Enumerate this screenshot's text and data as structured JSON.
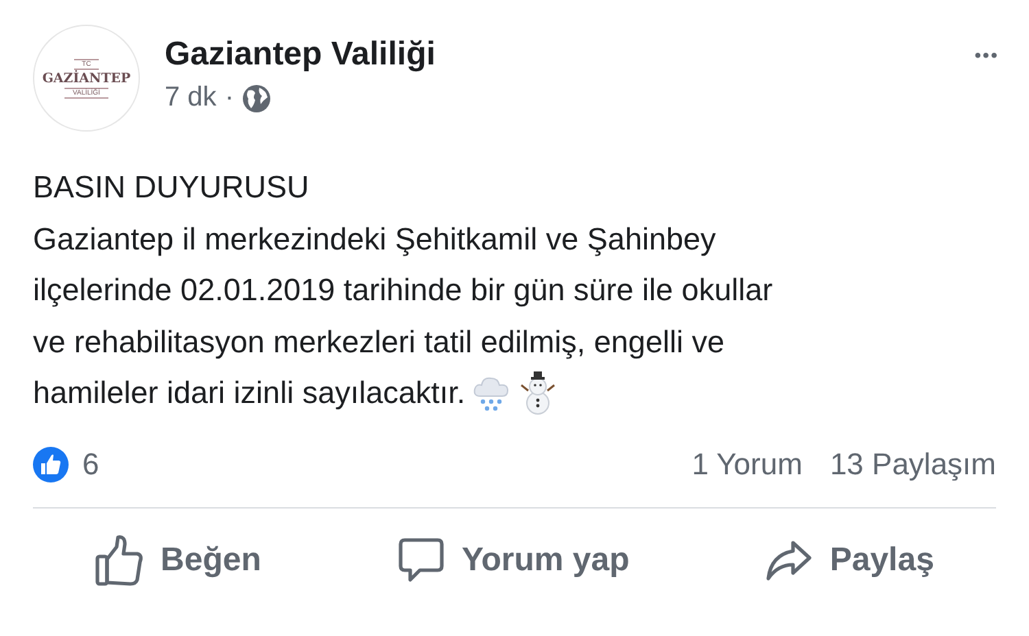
{
  "post": {
    "author": "Gaziantep Valiliği",
    "logo": {
      "top": "TC",
      "main": "GAZİANTEP",
      "bottom": "VALİLİĞİ"
    },
    "time": "7 dk",
    "separator": "·",
    "more": "•••",
    "lines": [
      "BASIN DUYURUSU",
      "Gaziantep il merkezindeki Şehitkamil ve Şahinbey",
      "ilçelerinde 02.01.2019 tarihinde bir gün süre ile okullar",
      "ve rehabilitasyon merkezleri tatil edilmiş, engelli ve",
      "hamileler idari izinli sayılacaktır."
    ],
    "reactions": "6",
    "comments": "1 Yorum",
    "shares": "13 Paylaşım",
    "actions": [
      {
        "kind": "like",
        "label": "Beğen"
      },
      {
        "kind": "comment",
        "label": "Yorum yap"
      },
      {
        "kind": "share",
        "label": "Paylaş"
      }
    ]
  }
}
